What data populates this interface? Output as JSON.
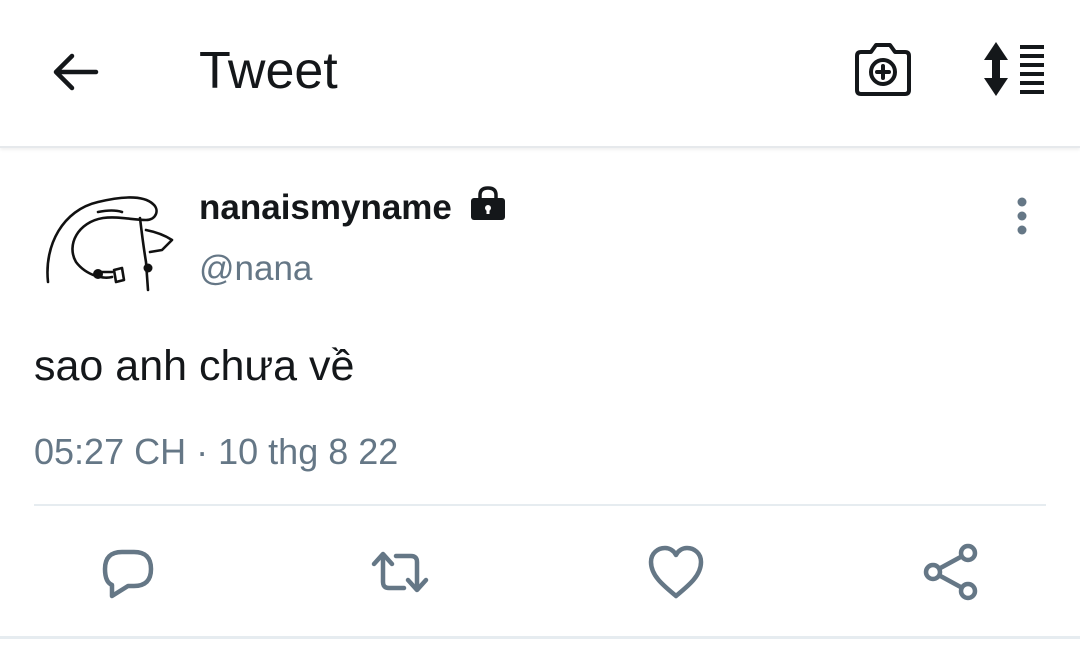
{
  "header": {
    "title": "Tweet",
    "back_icon": "arrow-left-icon",
    "camera_icon": "camera-plus-icon",
    "sort_icon": "sort-list-icon"
  },
  "tweet": {
    "display_name": "nanaismyname",
    "handle": "@nana",
    "protected_icon": "lock-icon",
    "text": "sao anh chưa về",
    "time": "05:27 CH",
    "separator": "·",
    "date": "10 thg 8 22"
  },
  "actions": [
    {
      "name": "reply",
      "icon": "reply-icon"
    },
    {
      "name": "retweet",
      "icon": "retweet-icon"
    },
    {
      "name": "like",
      "icon": "heart-icon"
    },
    {
      "name": "share",
      "icon": "share-icon"
    }
  ],
  "colors": {
    "text_primary": "#14171a",
    "text_secondary": "#657786",
    "action_icon": "#657786",
    "divider": "#e6ecf0"
  }
}
